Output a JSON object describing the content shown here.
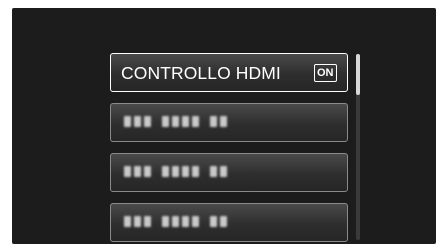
{
  "menu": {
    "items": [
      {
        "label": "CONTROLLO HDMI",
        "value": "ON",
        "selected": true
      },
      {
        "label": "",
        "obscured": true
      },
      {
        "label": "",
        "obscured": true
      },
      {
        "label": "",
        "obscured": true
      }
    ]
  },
  "scrollbar": {
    "position_fraction": 0.0,
    "visible_fraction": 0.22
  },
  "colors": {
    "screen_background": "#1c1c1c",
    "item_background": "#333333",
    "item_border": "#8a8a8a",
    "selected_border": "#ffffff",
    "text": "#ffffff"
  }
}
